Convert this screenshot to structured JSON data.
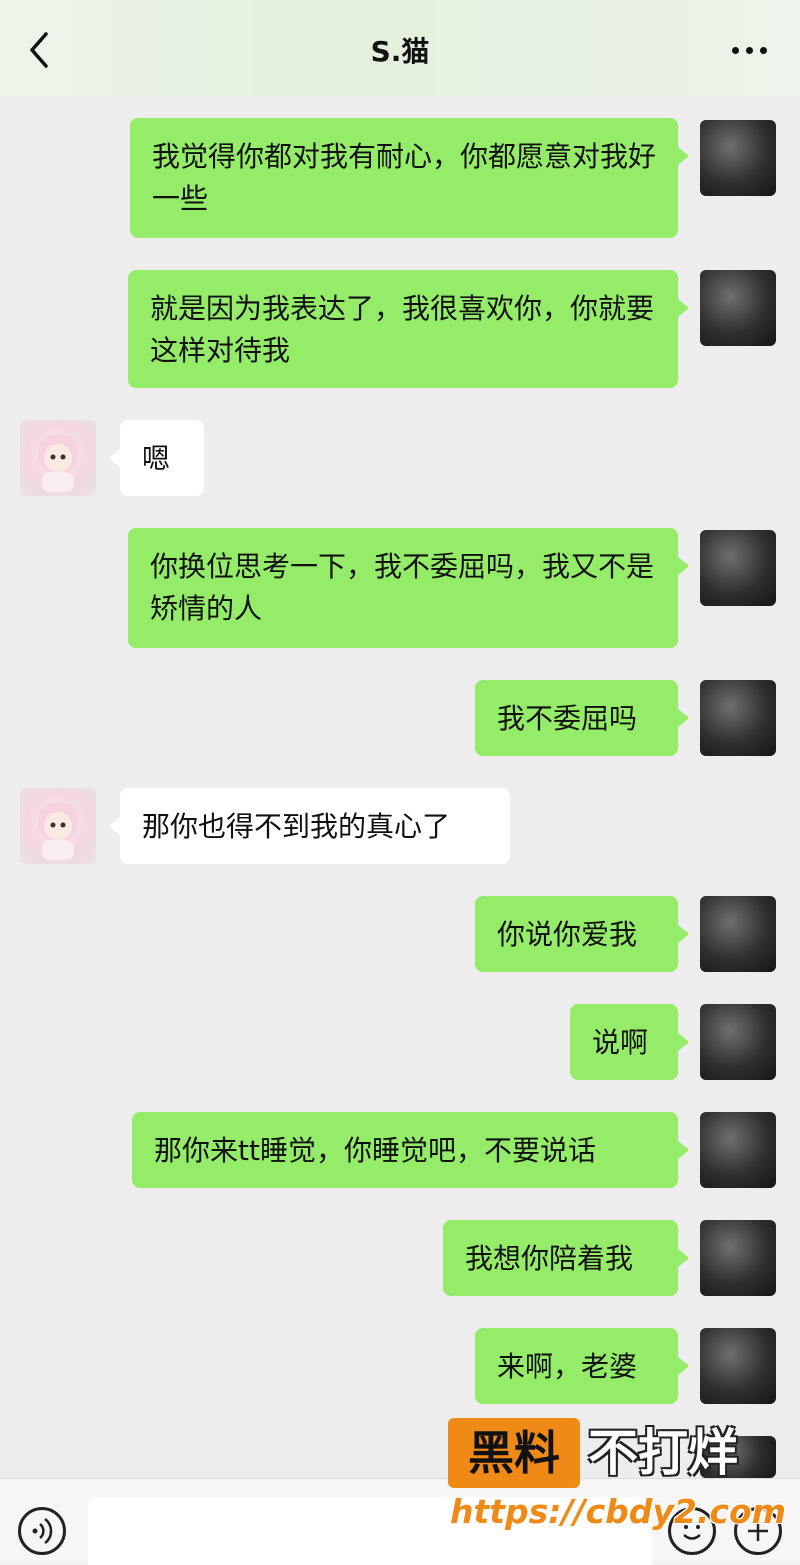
{
  "header": {
    "title": "S.猫",
    "back_icon": "chevron-left-icon",
    "more_icon": "more-dots-icon"
  },
  "messages": [
    {
      "sender": "me",
      "text": "我觉得你都对我有耐心，你都愿意对我好一些"
    },
    {
      "sender": "me",
      "text": "就是因为我表达了，我很喜欢你，你就要这样对待我"
    },
    {
      "sender": "other",
      "text": "嗯"
    },
    {
      "sender": "me",
      "text": "你换位思考一下，我不委屈吗，我又不是矫情的人"
    },
    {
      "sender": "me",
      "text": "我不委屈吗"
    },
    {
      "sender": "other",
      "text": "那你也得不到我的真心了"
    },
    {
      "sender": "me",
      "text": "你说你爱我"
    },
    {
      "sender": "me",
      "text": "说啊"
    },
    {
      "sender": "me",
      "text": "那你来tt睡觉，你睡觉吧，不要说话"
    },
    {
      "sender": "me",
      "text": "我想你陪着我"
    },
    {
      "sender": "me",
      "text": "来啊，老婆"
    }
  ],
  "input_bar": {
    "voice_icon": "voice-icon",
    "emoji_icon": "emoji-icon",
    "plus_icon": "plus-icon"
  },
  "watermark": {
    "badge": "黑料",
    "text": "不打烊",
    "url": "https://cbdy2.com"
  },
  "colors": {
    "my_bubble": "#95ec69",
    "other_bubble": "#ffffff",
    "background": "#ededed",
    "watermark_orange": "#f08a16"
  }
}
